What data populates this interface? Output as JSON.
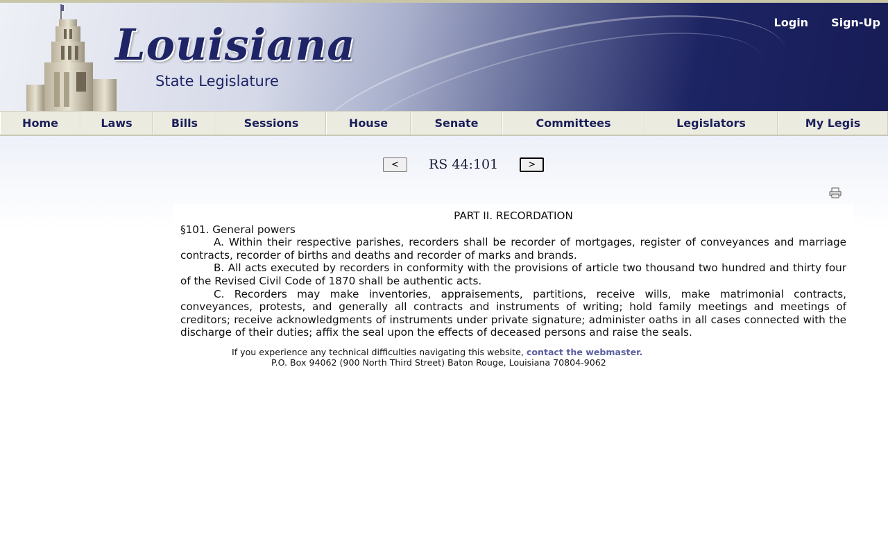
{
  "header": {
    "logo_title": "Louisiana",
    "logo_subtitle": "State Legislature",
    "login": "Login",
    "signup": "Sign-Up"
  },
  "nav": [
    {
      "label": "Home",
      "width": 116
    },
    {
      "label": "Laws",
      "width": 104
    },
    {
      "label": "Bills",
      "width": 92
    },
    {
      "label": "Sessions",
      "width": 158
    },
    {
      "label": "House",
      "width": 122
    },
    {
      "label": "Senate",
      "width": 132
    },
    {
      "label": "Committees",
      "width": 205
    },
    {
      "label": "Legislators",
      "width": 192
    },
    {
      "label": "My Legis",
      "width": 159
    }
  ],
  "pager": {
    "prev": "<",
    "next": ">",
    "section": "RS 44:101"
  },
  "document": {
    "part": "PART II.  RECORDATION",
    "heading": "§101.  General powers",
    "para_a": "A.  Within their respective parishes, recorders shall be recorder of mortgages, register of conveyances and marriage contracts, recorder of births and deaths and recorder of marks and brands.",
    "para_b": "B.  All acts executed by recorders in conformity with the provisions of article two thousand two hundred and thirty four of the Revised Civil Code of 1870 shall be authentic acts.",
    "para_c": "C.  Recorders may make inventories, appraisements, partitions, receive wills, make matrimonial contracts, conveyances, protests, and generally all contracts and instruments of writing; hold family meetings and meetings of creditors; receive acknowledgments of instruments under private signature; administer oaths in all cases connected with the discharge of their duties; affix the seal upon the effects of deceased persons and raise the seals."
  },
  "footer": {
    "text": "If you experience any technical difficulties navigating this website, ",
    "link": "contact the webmaster.",
    "address": "P.O. Box 94062 (900 North Third Street) Baton Rouge, Louisiana 70804-9062"
  },
  "icons": {
    "print": "printer-icon"
  }
}
